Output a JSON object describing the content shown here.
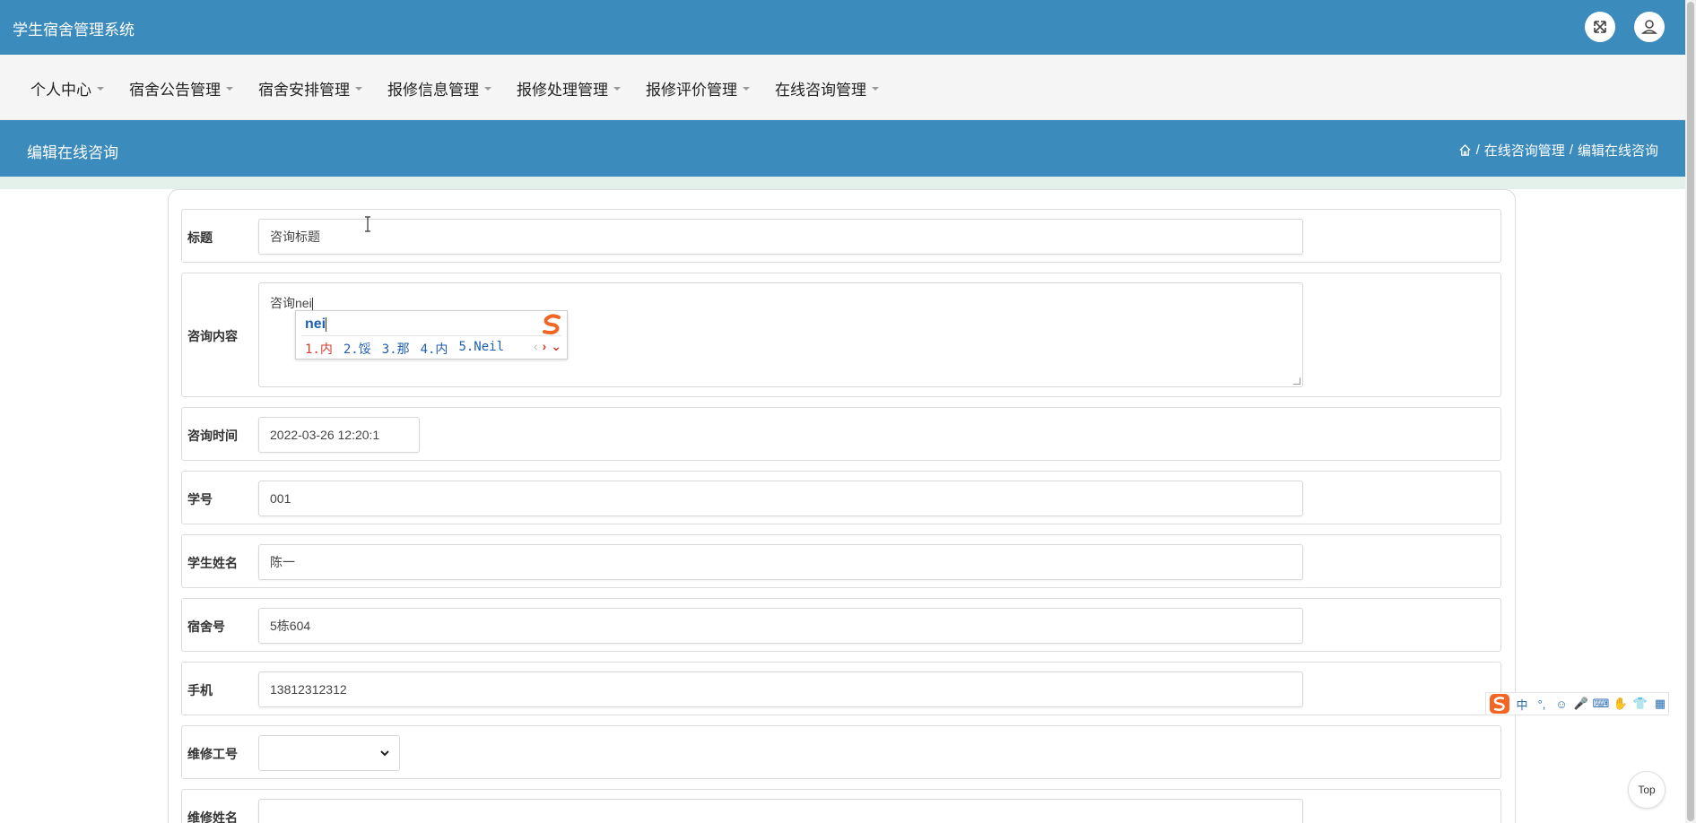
{
  "app": {
    "title": "学生宿舍管理系统"
  },
  "topbar": {
    "fullscreen_icon": "fullscreen-icon",
    "user_icon": "user-icon"
  },
  "nav": {
    "items": [
      {
        "label": "个人中心"
      },
      {
        "label": "宿舍公告管理"
      },
      {
        "label": "宿舍安排管理"
      },
      {
        "label": "报修信息管理"
      },
      {
        "label": "报修处理管理"
      },
      {
        "label": "报修评价管理"
      },
      {
        "label": "在线咨询管理"
      }
    ]
  },
  "page_header": {
    "title": "编辑在线咨询",
    "breadcrumb": {
      "home_icon": "home-icon",
      "sep1": "/",
      "level1": "在线咨询管理",
      "sep2": "/",
      "level2": "编辑在线咨询"
    }
  },
  "form": {
    "title": {
      "label": "标题",
      "value": "咨询标题"
    },
    "content": {
      "label": "咨询内容",
      "value": "咨询nei"
    },
    "time": {
      "label": "咨询时间",
      "value": "2022-03-26 12:20:1"
    },
    "student_id": {
      "label": "学号",
      "value": "001"
    },
    "student_name": {
      "label": "学生姓名",
      "value": "陈一"
    },
    "dorm_no": {
      "label": "宿舍号",
      "value": "5栋604"
    },
    "phone": {
      "label": "手机",
      "value": "13812312312"
    },
    "repair_id": {
      "label": "维修工号",
      "value": ""
    },
    "repair_name": {
      "label": "维修姓名",
      "value": ""
    }
  },
  "ime_popup": {
    "composition": "nei",
    "candidates": [
      "1.内",
      "2.馁",
      "3.那",
      "4.内",
      "5.Neil"
    ],
    "prev": "‹",
    "next": "›",
    "expand": "⌄"
  },
  "ime_toolbar": {
    "items": [
      "中",
      "°,",
      "☺",
      "🎤",
      "⌨",
      "✋",
      "👕",
      "▦"
    ]
  },
  "back_to_top": {
    "label": "Top"
  },
  "colors": {
    "header_blue": "#3b8bbd",
    "nav_bg": "#f5f5f5",
    "strip_green": "#e4f1ea",
    "ime_orange": "#f26522"
  }
}
